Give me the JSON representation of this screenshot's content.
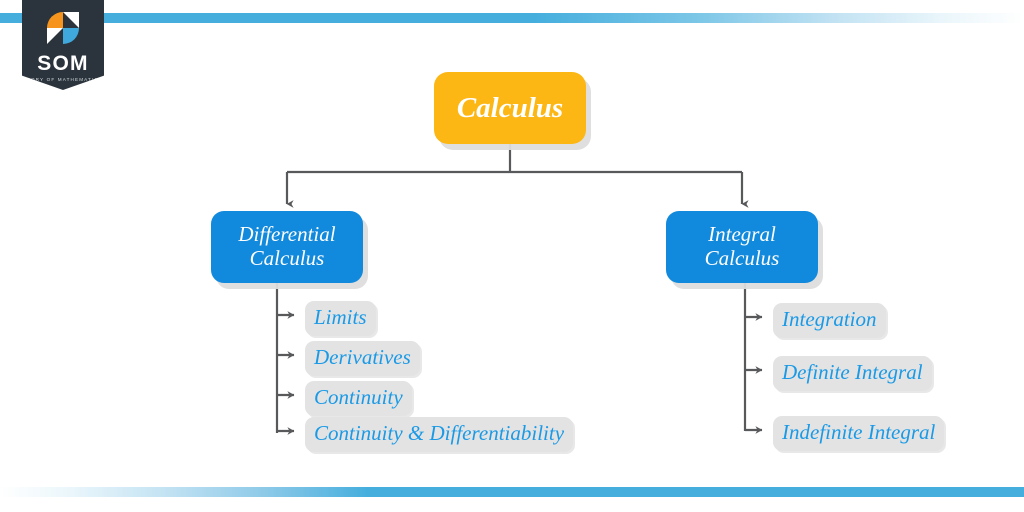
{
  "brand": {
    "name": "SOM",
    "tagline": "STORY OF MATHEMATICS",
    "mark": "som-logo-mark",
    "colors": {
      "panel": "#2b343d",
      "orange": "#f7941e",
      "blue": "#3fa9dd",
      "white": "#ffffff"
    }
  },
  "decor": {
    "top_band_color": "#45aedd",
    "bottom_band_color": "#45aedd"
  },
  "diagram": {
    "type": "tree",
    "colors": {
      "root_box": "#fcb714",
      "branch_box": "#1189dc",
      "leaf_pill": "#e3e3e3",
      "leaf_text": "#1a9ae6",
      "connector": "#58595b",
      "node_text": "#ffffff"
    },
    "root": {
      "label": "Calculus"
    },
    "branches": [
      {
        "id": "differential",
        "label_line1": "Differential",
        "label_line2": "Calculus",
        "leaves": [
          {
            "label": "Limits"
          },
          {
            "label": "Derivatives"
          },
          {
            "label": "Continuity"
          },
          {
            "label": "Continuity & Differentiability"
          }
        ]
      },
      {
        "id": "integral",
        "label_line1": "Integral",
        "label_line2": "Calculus",
        "leaves": [
          {
            "label": "Integration"
          },
          {
            "label": "Definite Integral"
          },
          {
            "label": "Indefinite Integral"
          }
        ]
      }
    ]
  }
}
